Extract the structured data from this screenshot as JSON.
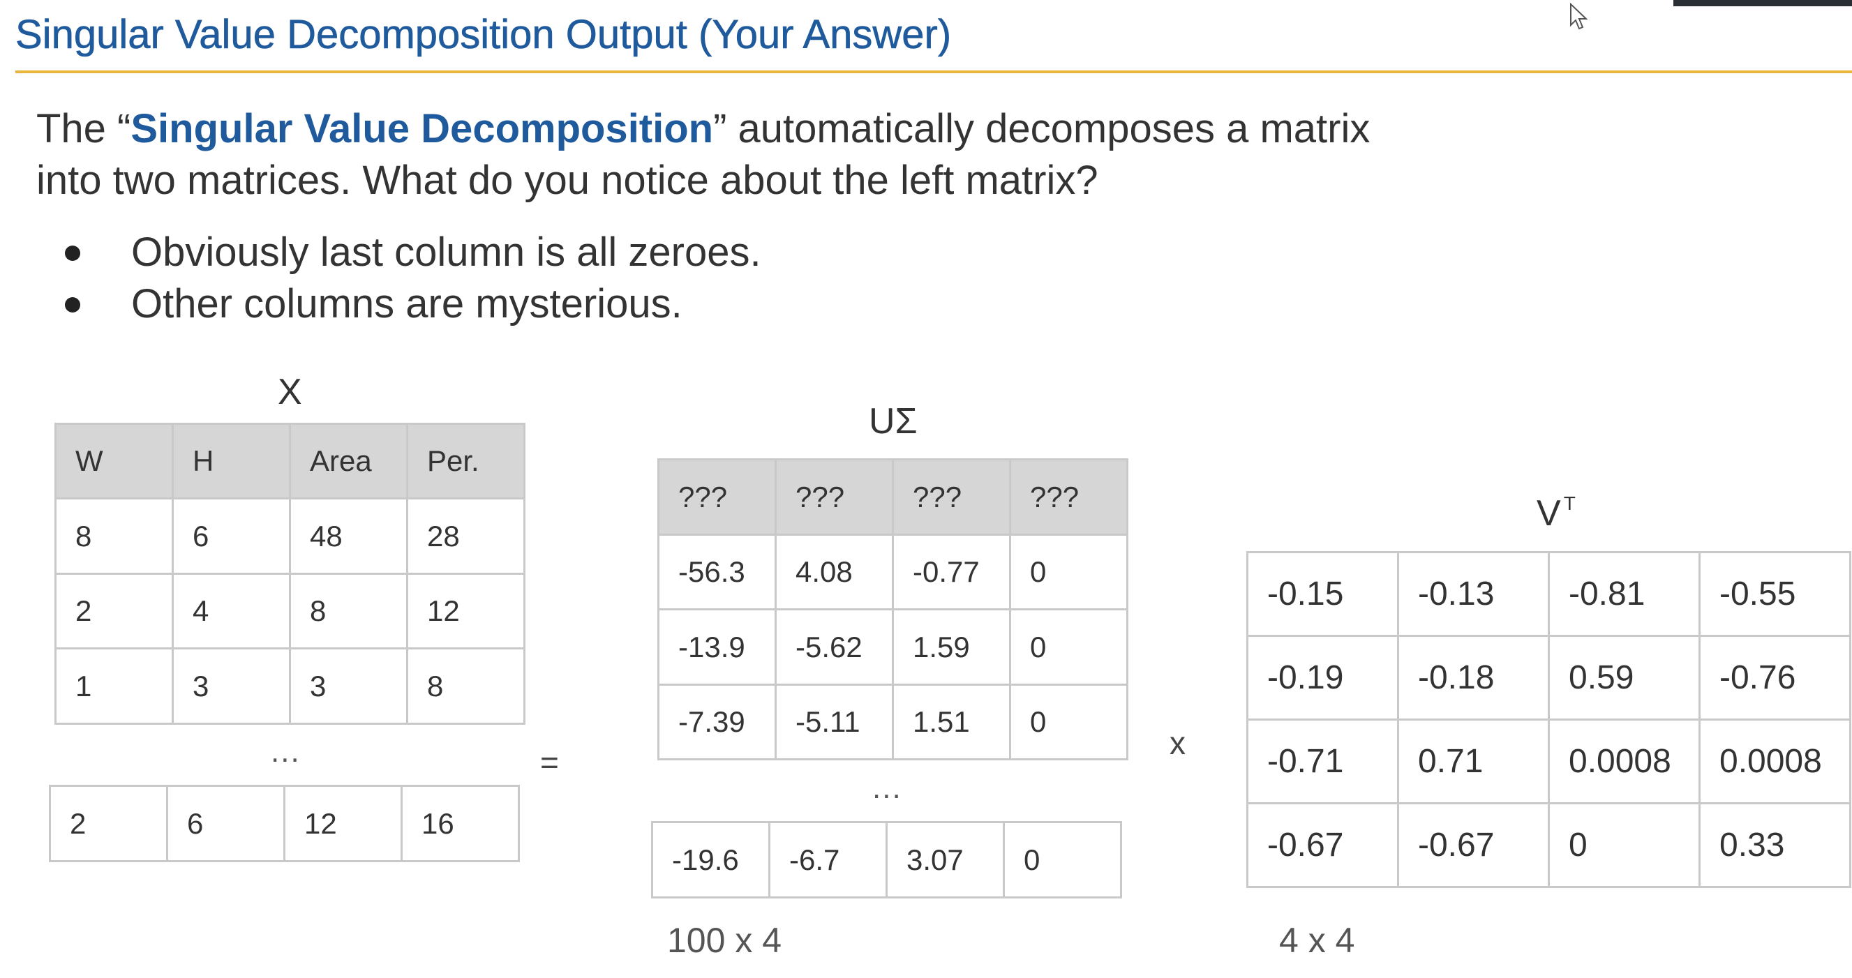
{
  "slide": {
    "title": "Singular Value Decomposition Output (Your Answer)",
    "accent_color": "#1f5a9c",
    "rule_color": "#e8b63a"
  },
  "intro": {
    "part1": "The “",
    "highlight": "Singular Value Decomposition",
    "part2": "” automatically decomposes a matrix",
    "line2": "into two matrices. What do you notice about the left matrix?"
  },
  "bullets": [
    "Obviously last column is all zeroes.",
    "Other columns are mysterious."
  ],
  "matrix_x": {
    "label": "X",
    "headers": [
      "W",
      "H",
      "Area",
      "Per."
    ],
    "rows": [
      [
        "8",
        "6",
        "48",
        "28"
      ],
      [
        "2",
        "4",
        "8",
        "12"
      ],
      [
        "1",
        "3",
        "3",
        "8"
      ]
    ],
    "ellipsis": "...",
    "last_row": [
      "2",
      "6",
      "12",
      "16"
    ]
  },
  "equals_sign": "=",
  "matrix_u_sigma": {
    "label": "UΣ",
    "headers": [
      "???",
      "???",
      "???",
      "???"
    ],
    "rows": [
      [
        "-56.3",
        "4.08",
        "-0.77",
        "0"
      ],
      [
        "-13.9",
        "-5.62",
        "1.59",
        "0"
      ],
      [
        "-7.39",
        "-5.11",
        "1.51",
        "0"
      ]
    ],
    "ellipsis": "...",
    "last_row": [
      "-19.6",
      "-6.7",
      "3.07",
      "0"
    ],
    "dimensions": "100 x 4"
  },
  "times_sign": "x",
  "matrix_vt": {
    "label_base": "V",
    "label_sup": "T",
    "rows": [
      [
        "-0.15",
        "-0.13",
        "-0.81",
        "-0.55"
      ],
      [
        "-0.19",
        "-0.18",
        "0.59",
        "-0.76"
      ],
      [
        "-0.71",
        "0.71",
        "0.0008",
        "0.0008"
      ],
      [
        "-0.67",
        "-0.67",
        "0",
        "0.33"
      ]
    ],
    "dimensions": "4 x 4"
  }
}
